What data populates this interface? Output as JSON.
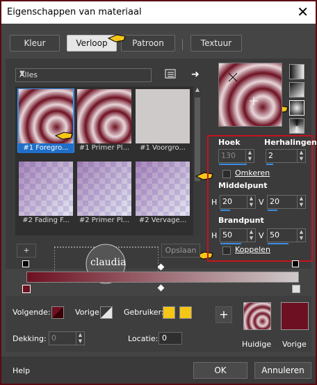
{
  "window": {
    "title": "Eigenschappen van materiaal",
    "close": "✕"
  },
  "tabs": [
    {
      "label": "Kleur"
    },
    {
      "label": "Verloop"
    },
    {
      "label": "Patroon"
    },
    {
      "label": "Textuur"
    }
  ],
  "library": {
    "filter": "Alles",
    "items": [
      {
        "caption": "#1 Foregro..."
      },
      {
        "caption": "#1 Primer Pl..."
      },
      {
        "caption": "#1 Voorgro..."
      },
      {
        "caption": "#2 Fading F..."
      },
      {
        "caption": "#2 Primer Pl..."
      },
      {
        "caption": "#2 Vervage..."
      }
    ],
    "buttons": {
      "add": "+",
      "save": "Opslaan"
    }
  },
  "gradient": {
    "hoek_label": "Hoek",
    "hoek": "130",
    "herhalingen_label": "Herhalingen",
    "herhalingen": "2",
    "omkeren_label": "Omkeren",
    "middelpunt_label": "Middelpunt",
    "mid_h_label": "H",
    "mid_h": "20",
    "mid_v_label": "V",
    "mid_v": "20",
    "brandpunt_label": "Brandpunt",
    "focus_h_label": "H",
    "focus_h": "50",
    "focus_v_label": "V",
    "focus_v": "50",
    "koppelen_label": "Koppelen"
  },
  "swatches": {
    "volgende_label": "Volgende:",
    "vorige_label": "Vorige:",
    "gebruiker_label": "Gebruiker:",
    "dekking_label": "Dekking:",
    "dekking": "0",
    "locatie_label": "Locatie:",
    "locatie": "0",
    "huidige_label": "Huidige",
    "vorige_big_label": "Vorige",
    "plus": "+",
    "accent": "#6d1021"
  },
  "watermark": {
    "text": "claudia"
  },
  "footer": {
    "help": "Help",
    "ok": "OK",
    "cancel": "Annuleren"
  }
}
